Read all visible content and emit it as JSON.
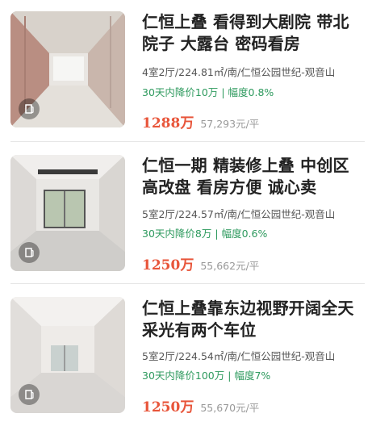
{
  "listings": [
    {
      "title": "仁恒上叠 看得到大剧院 带北院子 大露台 密码看房",
      "specs": "4室2厅/224.81㎡/南/仁恒公园世纪-观音山",
      "drop_days": "30天内降价10万",
      "drop_separator": "|",
      "drop_pct": "幅度0.8%",
      "price": "1288万",
      "unit_price": "57,293元/平",
      "vr_icon": "vr-tour-icon"
    },
    {
      "title": "仁恒一期 精装修上叠 中创区 高改盘 看房方便 诚心卖",
      "specs": "5室2厅/224.57㎡/南/仁恒公园世纪-观音山",
      "drop_days": "30天内降价8万",
      "drop_separator": "|",
      "drop_pct": "幅度0.6%",
      "price": "1250万",
      "unit_price": "55,662元/平",
      "vr_icon": "vr-tour-icon"
    },
    {
      "title": "仁恒上叠靠东边视野开阔全天采光有两个车位",
      "specs": "5室2厅/224.54㎡/南/仁恒公园世纪-观音山",
      "drop_days": "30天内降价100万",
      "drop_separator": "|",
      "drop_pct": "幅度7%",
      "price": "1250万",
      "unit_price": "55,670元/平",
      "vr_icon": "vr-tour-icon"
    }
  ],
  "colors": {
    "price": "#e8553a",
    "drop": "#2e9a5e",
    "specs": "#555555",
    "unit_price": "#999999",
    "divider": "#e6e6e6"
  }
}
